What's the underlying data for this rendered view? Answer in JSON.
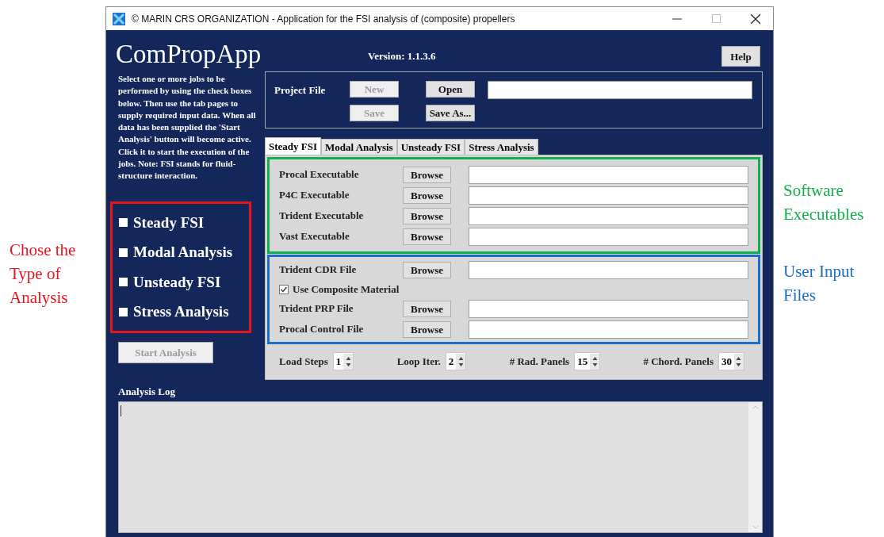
{
  "annotations": [
    {
      "text": "Chose the Type of Analysis",
      "color": "#e8141c"
    },
    {
      "text": "Software Executables",
      "color": "#12b04a"
    },
    {
      "text": "User Input Files",
      "color": "#1a6fc4"
    }
  ],
  "window": {
    "title": "© MARIN CRS ORGANIZATION - Application for the FSI analysis of (composite) propellers"
  },
  "app": {
    "name": "ComPropApp",
    "version": "Version: 1.1.3.6",
    "help_button": "Help"
  },
  "instructions": "Select one or more jobs to be performed by using the check boxes below. Then use the tab pages to supply required input data. When all data has been supplied the 'Start Analysis' button will become active. Click it to start the execution of the jobs. Note: FSI stands for fluid-structure interaction.",
  "job_checkboxes": [
    {
      "label": "Steady FSI",
      "checked": false
    },
    {
      "label": "Modal Analysis",
      "checked": false
    },
    {
      "label": "Unsteady FSI",
      "checked": false
    },
    {
      "label": "Stress Analysis",
      "checked": false
    }
  ],
  "start_button": {
    "label": "Start Analysis",
    "disabled": true
  },
  "project_file": {
    "label": "Project File",
    "buttons": [
      {
        "label": "New",
        "disabled": true
      },
      {
        "label": "Open",
        "disabled": false
      },
      {
        "label": "Save",
        "disabled": true
      },
      {
        "label": "Save As...",
        "disabled": false
      }
    ]
  },
  "tabs": [
    {
      "label": "Steady FSI",
      "selected": true
    },
    {
      "label": "Modal Analysis",
      "selected": false
    },
    {
      "label": "Unsteady FSI",
      "selected": false
    },
    {
      "label": "Stress Analysis",
      "selected": false
    }
  ],
  "executables": [
    {
      "label": "Procal Executable",
      "button": "Browse"
    },
    {
      "label": "P4C Executable",
      "button": "Browse"
    },
    {
      "label": "Trident Executable",
      "button": "Browse"
    },
    {
      "label": "Vast Executable",
      "button": "Browse"
    }
  ],
  "input_files": [
    {
      "kind": "file",
      "label": "Trident CDR File",
      "button": "Browse"
    },
    {
      "kind": "checkbox",
      "label": "Use Composite Material",
      "checked": true
    },
    {
      "kind": "file",
      "label": "Trident PRP File",
      "button": "Browse"
    },
    {
      "kind": "file",
      "label": "Procal Control File",
      "button": "Browse"
    }
  ],
  "spinners": [
    {
      "label": "Load Steps",
      "value": "1"
    },
    {
      "label": "Loop Iter.",
      "value": "2"
    },
    {
      "label": "# Rad. Panels",
      "value": "15"
    },
    {
      "label": "# Chord. Panels",
      "value": "30"
    }
  ],
  "log": {
    "label": "Analysis Log"
  }
}
